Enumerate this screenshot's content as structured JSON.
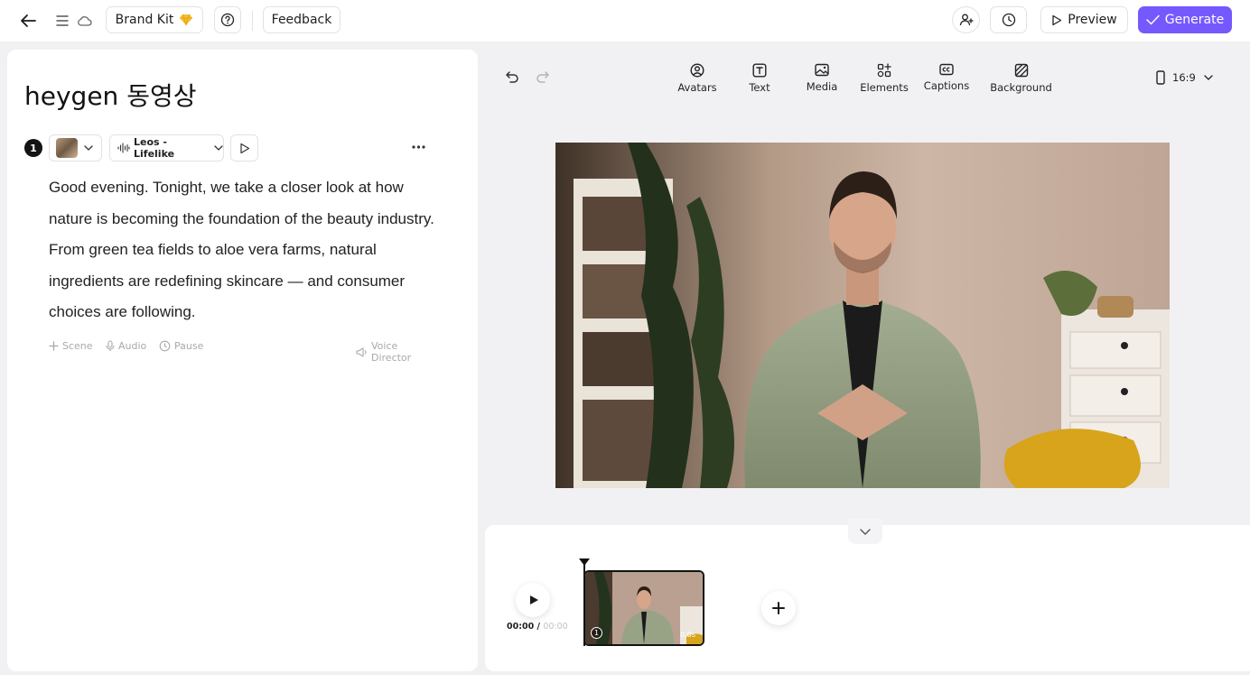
{
  "topbar": {
    "brand_kit_label": "Brand Kit",
    "feedback_label": "Feedback",
    "preview_label": "Preview",
    "generate_label": "Generate"
  },
  "project": {
    "title": "heygen 동영상"
  },
  "scene": {
    "number": "1",
    "voice_name": "Leos - Lifelike",
    "script": "Good evening. Tonight, we take a closer look at how nature is becoming the foundation of the beauty industry. From green tea fields to aloe vera farms, natural ingredients are redefining skincare — and consumer choices are following.",
    "actions": {
      "scene": "Scene",
      "audio": "Audio",
      "pause": "Pause",
      "voice_director": "Voice Director"
    }
  },
  "toolbar": {
    "avatars": "Avatars",
    "text": "Text",
    "media": "Media",
    "elements": "Elements",
    "captions": "Captions",
    "background": "Background",
    "aspect_ratio": "16:9"
  },
  "timeline": {
    "current_time": "00:00",
    "separator": " / ",
    "total_time": "00:00",
    "clip_index": "1",
    "clip_duration": "0.0s"
  },
  "colors": {
    "accent": "#7559ff",
    "panel_bg": "#ffffff",
    "app_bg": "#f1f1f3"
  }
}
